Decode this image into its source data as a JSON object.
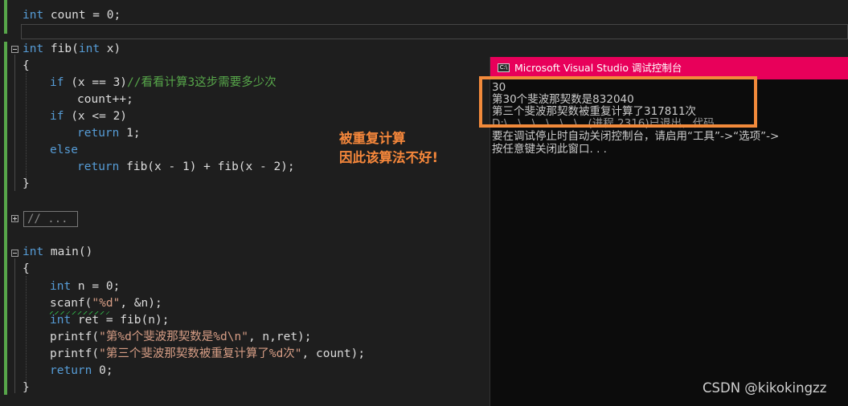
{
  "editor": {
    "line1": {
      "kw": "int",
      "rest": " count = 0;"
    },
    "fib_sig": {
      "kw1": "int",
      "name": " fib(",
      "kw2": "int",
      "rest": " x)"
    },
    "open_brace": "{",
    "close_brace": "}",
    "if1": {
      "kw": "if",
      "cond": " (x == 3)",
      "comment": "//看看计算3这步需要多少次"
    },
    "count_inc": "count++;",
    "if2": {
      "kw": "if",
      "cond": " (x <= 2)"
    },
    "return1": {
      "kw": "return",
      "rest": " 1;"
    },
    "else": {
      "kw": "else"
    },
    "return2": {
      "kw": "return",
      "rest": " fib(x - 1) + fib(x - 2);"
    },
    "collapsed_region": "// ...",
    "main_sig": {
      "kw": "int",
      "rest": " main()"
    },
    "m1": {
      "kw": "int",
      "rest": " n = 0;"
    },
    "m2": {
      "a": "scanf(",
      "s": "\"%d\"",
      "b": ", &n);"
    },
    "m3": {
      "kw": "int",
      "rest": " ret = fib(n);"
    },
    "m4": {
      "a": "printf(",
      "s": "\"第%d个斐波那契数是%d\\n\"",
      "b": ", n,ret);"
    },
    "m5": {
      "a": "printf(",
      "s": "\"第三个斐波那契数被重复计算了%d次\"",
      "b": ", count);"
    },
    "m6": {
      "kw": "return",
      "rest": " 0;"
    }
  },
  "annotation": {
    "line1": "被重复计算",
    "line2": "因此该算法不好!"
  },
  "console": {
    "title": "Microsoft Visual Studio 调试控制台",
    "icon_label": "C:\\",
    "lines": [
      "30",
      "第30个斐波那契数是832040",
      "第三个斐波那契数被重复计算了317811次",
      "D:\\...\\...\\...\\...\\...\\...(进程 2316)已退出，代码",
      "要在调试停止时自动关闭控制台，请启用“工具”->“选项”->",
      "按任意键关闭此窗口. . ."
    ]
  },
  "watermark": "CSDN @kikokingzz",
  "colors": {
    "keyword": "#569cd6",
    "comment": "#57a64a",
    "string": "#d69d85",
    "console_title_bg": "#e8005a",
    "highlight_box": "#f28a3b",
    "annotation": "#f5873b"
  }
}
